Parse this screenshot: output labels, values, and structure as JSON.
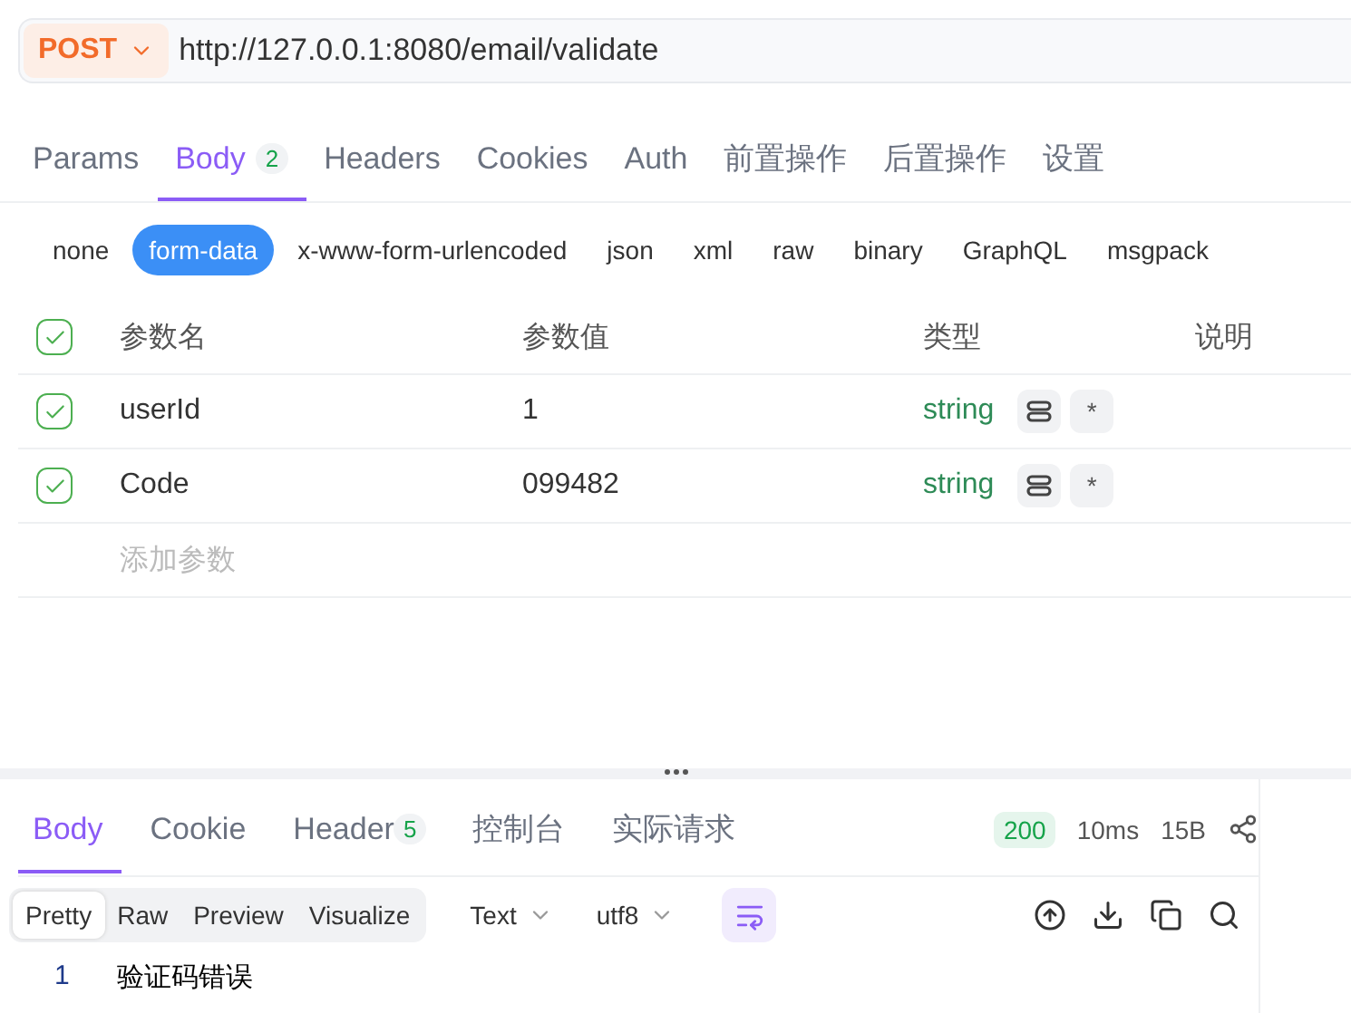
{
  "request": {
    "method": "POST",
    "url": "http://127.0.0.1:8080/email/validate"
  },
  "tabs": [
    {
      "label": "Params",
      "selected": false
    },
    {
      "label": "Body",
      "selected": true,
      "badge": "2"
    },
    {
      "label": "Headers",
      "selected": false
    },
    {
      "label": "Cookies",
      "selected": false
    },
    {
      "label": "Auth",
      "selected": false
    },
    {
      "label": "前置操作",
      "selected": false
    },
    {
      "label": "后置操作",
      "selected": false
    },
    {
      "label": "设置",
      "selected": false
    }
  ],
  "body_types": [
    {
      "label": "none",
      "selected": false
    },
    {
      "label": "form-data",
      "selected": true
    },
    {
      "label": "x-www-form-urlencoded",
      "selected": false
    },
    {
      "label": "json",
      "selected": false
    },
    {
      "label": "xml",
      "selected": false
    },
    {
      "label": "raw",
      "selected": false
    },
    {
      "label": "binary",
      "selected": false
    },
    {
      "label": "GraphQL",
      "selected": false
    },
    {
      "label": "msgpack",
      "selected": false
    }
  ],
  "table": {
    "header_checked": true,
    "columns": [
      "参数名",
      "参数值",
      "类型",
      "说明"
    ],
    "rows": [
      {
        "checked": true,
        "name": "userId",
        "value": "1",
        "type": "string",
        "required_mark": "*"
      },
      {
        "checked": true,
        "name": "Code",
        "value": "099482",
        "type": "string",
        "required_mark": "*"
      }
    ],
    "add_placeholder": "添加参数"
  },
  "response": {
    "tabs": [
      {
        "label": "Body",
        "selected": true
      },
      {
        "label": "Cookie",
        "selected": false
      },
      {
        "label": "Header",
        "selected": false,
        "badge": "5"
      },
      {
        "label": "控制台",
        "selected": false
      },
      {
        "label": "实际请求",
        "selected": false
      }
    ],
    "status": "200",
    "time": "10ms",
    "size": "15B",
    "views": [
      {
        "label": "Pretty",
        "selected": true
      },
      {
        "label": "Raw",
        "selected": false
      },
      {
        "label": "Preview",
        "selected": false
      },
      {
        "label": "Visualize",
        "selected": false
      }
    ],
    "format": "Text",
    "encoding": "utf8",
    "lines": [
      {
        "number": "1",
        "text": "验证码错误"
      }
    ]
  }
}
